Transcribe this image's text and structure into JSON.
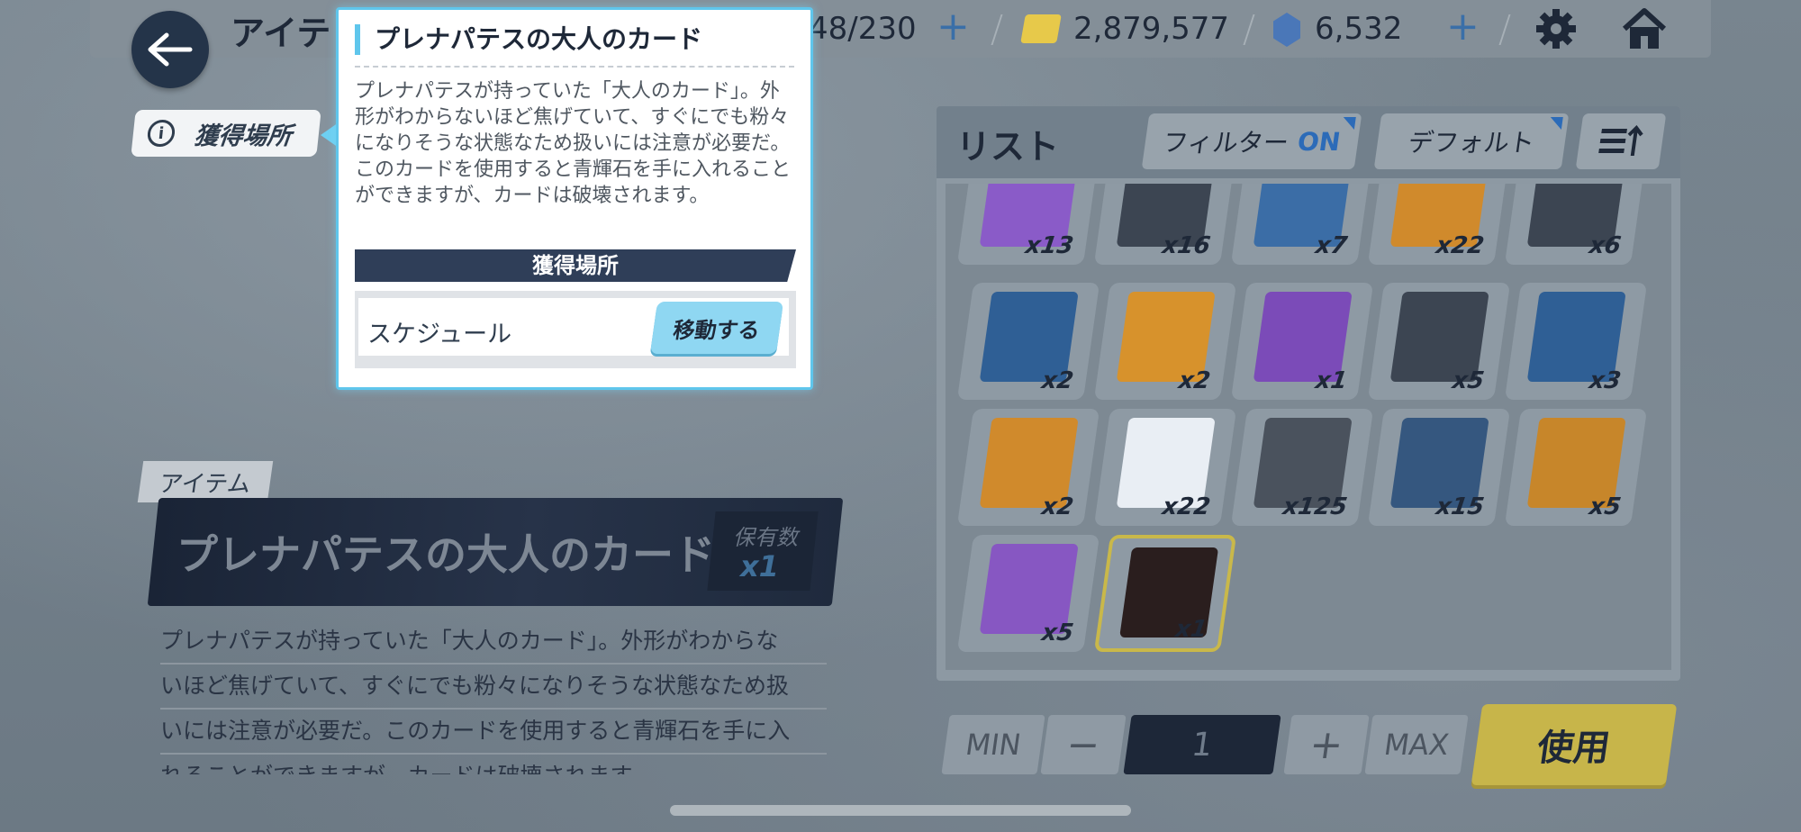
{
  "topbar": {
    "title": "アイテ",
    "ap": "48/230",
    "credits": "2,879,577",
    "gems": "6,532"
  },
  "acquisition_tag": {
    "label": "獲得場所"
  },
  "popup": {
    "title": "プレナパテスの大人のカード",
    "description": "プレナパテスが持っていた「大人のカード」。外形がわからないほど焦げていて、すぐにでも粉々になりそうな状態なため扱いには注意が必要だ。このカードを使用すると青輝石を手に入れることができますが、カードは破壊されます。",
    "section_header": "獲得場所",
    "source_label": "スケジュール",
    "move_button": "移動する"
  },
  "item": {
    "tag": "アイテム",
    "name": "プレナパテスの大人のカード",
    "owned_label": "保有数",
    "owned_count": "x1",
    "description_lines": [
      "プレナパテスが持っていた「大人のカード」。外形がわからな",
      "いほど焦げていて、すぐにでも粉々になりそうな状態なため扱",
      "いには注意が必要だ。このカードを使用すると青輝石を手に入",
      "れることができますが、カードは破壊されます。"
    ]
  },
  "list": {
    "title": "リスト",
    "filter_label": "フィルター",
    "filter_state": "ON",
    "sort_label": "デフォルト",
    "items": [
      {
        "qty": "x13",
        "color": "#8a5bc8"
      },
      {
        "qty": "x16",
        "color": "#3c4552"
      },
      {
        "qty": "x7",
        "color": "#3b6da6"
      },
      {
        "qty": "x22",
        "color": "#d08a2c"
      },
      {
        "qty": "x6",
        "color": "#3c4552"
      },
      {
        "qty": "x2",
        "color": "#2f5f95"
      },
      {
        "qty": "x2",
        "color": "#d7922c"
      },
      {
        "qty": "x1",
        "color": "#7b4bb8"
      },
      {
        "qty": "x5",
        "color": "#3c4552"
      },
      {
        "qty": "x3",
        "color": "#2f5f95"
      },
      {
        "qty": "x2",
        "color": "#d08a2c"
      },
      {
        "qty": "x22",
        "color": "#e9eef4"
      },
      {
        "qty": "x125",
        "color": "#4a525d"
      },
      {
        "qty": "x15",
        "color": "#35577f"
      },
      {
        "qty": "x5",
        "color": "#c7862a"
      },
      {
        "qty": "x5",
        "color": "#8757c2"
      },
      {
        "qty": "x1",
        "color": "#2a1e1e"
      }
    ]
  },
  "controls": {
    "min_label": "MIN",
    "minus": "−",
    "quantity": "1",
    "plus": "+",
    "max_label": "MAX",
    "use_button": "使用"
  }
}
